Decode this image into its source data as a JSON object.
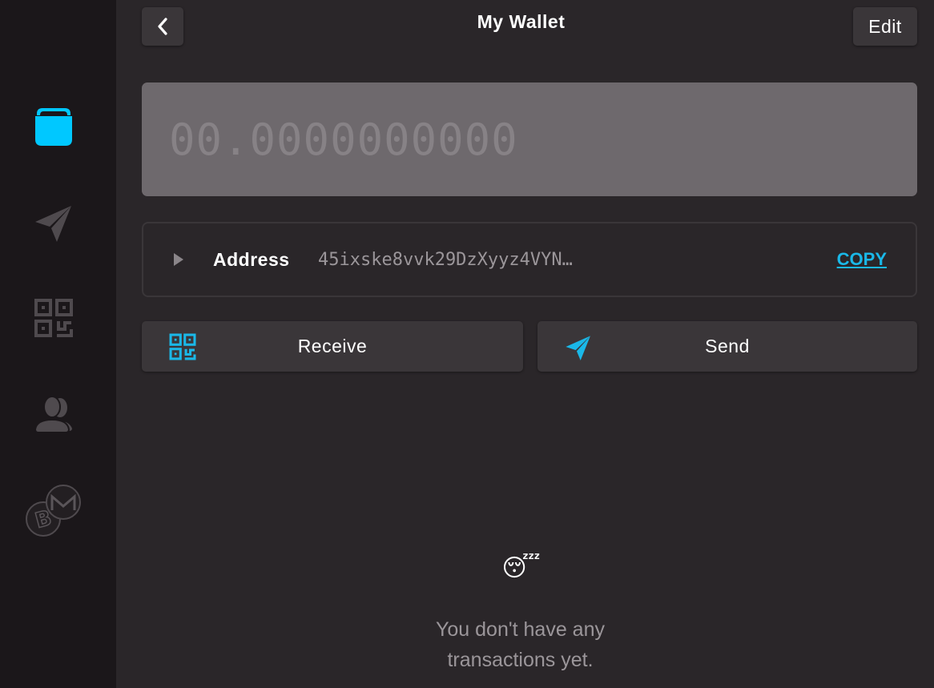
{
  "sidebar": {
    "items": [
      {
        "name": "wallet",
        "icon": "wallet-icon",
        "active": true
      },
      {
        "name": "send",
        "icon": "paper-plane-icon",
        "active": false
      },
      {
        "name": "receive",
        "icon": "qr-code-icon",
        "active": false
      },
      {
        "name": "contacts",
        "icon": "contacts-icon",
        "active": false
      },
      {
        "name": "exchange",
        "icon": "bitcoin-monero-icon",
        "active": false
      }
    ]
  },
  "header": {
    "title": "My Wallet",
    "back_icon": "chevron-left-icon",
    "edit_label": "Edit"
  },
  "balance": {
    "value": "00.0000000000"
  },
  "address": {
    "label": "Address",
    "value": "45ixske8vvk29DzXyyz4VYN…",
    "copy_label": "COPY"
  },
  "actions": {
    "receive_label": "Receive",
    "send_label": "Send"
  },
  "empty_state": {
    "emoji": "😴",
    "message": "You don't have any transactions yet."
  },
  "colors": {
    "accent": "#1ab8e8",
    "active_icon": "#00c8ff",
    "inactive_icon": "#4f4a4e",
    "background": "#2a2629",
    "sidebar": "#1b171a"
  }
}
